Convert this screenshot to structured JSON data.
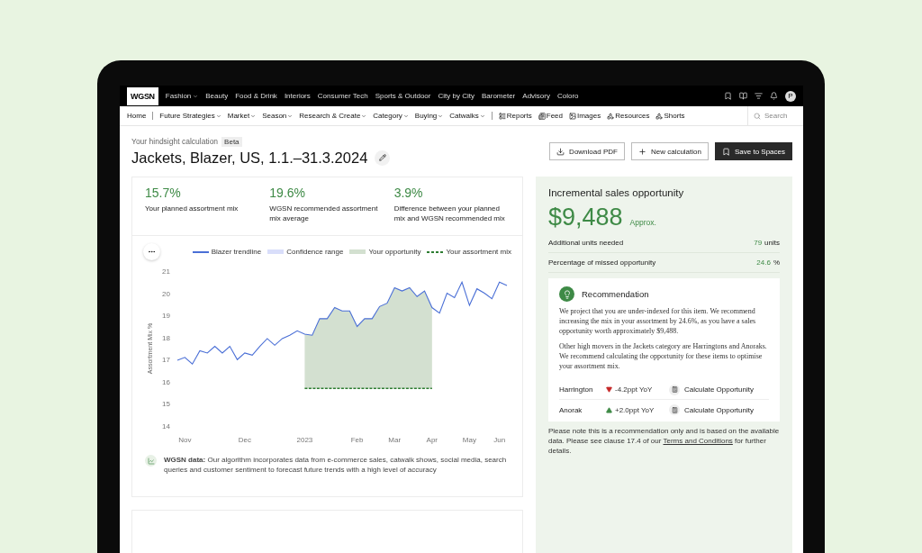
{
  "brand": "WGSN",
  "top_nav": [
    {
      "label": "Fashion",
      "dropdown": true
    },
    {
      "label": "Beauty",
      "dropdown": false
    },
    {
      "label": "Food & Drink",
      "dropdown": false
    },
    {
      "label": "Interiors",
      "dropdown": false
    },
    {
      "label": "Consumer Tech",
      "dropdown": false
    },
    {
      "label": "Sports & Outdoor",
      "dropdown": false
    },
    {
      "label": "City by City",
      "dropdown": false
    },
    {
      "label": "Barometer",
      "dropdown": false
    },
    {
      "label": "Advisory",
      "dropdown": false
    },
    {
      "label": "Coloro",
      "dropdown": false
    }
  ],
  "profile_initial": "P",
  "sub_nav": [
    {
      "label": "Home",
      "kind": "plain"
    },
    {
      "label": "Future Strategies",
      "kind": "menu"
    },
    {
      "label": "Market",
      "kind": "menu"
    },
    {
      "label": "Season",
      "kind": "menu"
    },
    {
      "label": "Research & Create",
      "kind": "menu"
    },
    {
      "label": "Category",
      "kind": "menu"
    },
    {
      "label": "Buying",
      "kind": "menu"
    },
    {
      "label": "Catwalks",
      "kind": "menu"
    },
    {
      "label": "Reports",
      "kind": "icon"
    },
    {
      "label": "Feed",
      "kind": "icon"
    },
    {
      "label": "Images",
      "kind": "icon"
    },
    {
      "label": "Resources",
      "kind": "icon"
    },
    {
      "label": "Shorts",
      "kind": "icon"
    }
  ],
  "search": {
    "placeholder": "Search"
  },
  "page": {
    "eyebrow": "Your hindsight calculation",
    "badge": "Beta",
    "title": "Jackets, Blazer, US, 1.1.–31.3.2024"
  },
  "actions": [
    {
      "label": "Download PDF",
      "kind": "outline"
    },
    {
      "label": "New calculation",
      "kind": "outline"
    },
    {
      "label": "Save to Spaces",
      "kind": "primary"
    }
  ],
  "metrics": [
    {
      "value": "15.7%",
      "label": "Your planned assortment mix"
    },
    {
      "value": "19.6%",
      "label": "WGSN recommended assortment mix average"
    },
    {
      "value": "3.9%",
      "label": "Difference between your planned mix and WGSN recommended mix"
    }
  ],
  "chart": {
    "chart_data": {
      "type": "line",
      "ylabel": "Assortment Mix %",
      "ylim": [
        14,
        21
      ],
      "categories": [
        null,
        "Nov",
        null,
        null,
        null,
        null,
        null,
        null,
        null,
        "Dec",
        null,
        null,
        null,
        null,
        null,
        null,
        null,
        "2023",
        null,
        null,
        null,
        null,
        null,
        null,
        "Feb",
        null,
        null,
        null,
        null,
        "Mar",
        null,
        null,
        null,
        null,
        "Apr",
        null,
        null,
        null,
        null,
        "May",
        null,
        null,
        null,
        "Jun",
        null
      ],
      "series": [
        {
          "name": "Blazer trendline",
          "type": "line",
          "line_style": "solid",
          "color": "#4a6fd6",
          "values": [
            16.97,
            17.1,
            16.8,
            17.4,
            17.3,
            17.6,
            17.3,
            17.6,
            17.0,
            17.3,
            17.2,
            17.6,
            17.95,
            17.65,
            17.95,
            18.1,
            18.3,
            18.15,
            18.1,
            18.85,
            18.85,
            19.35,
            19.2,
            19.2,
            18.5,
            18.85,
            18.85,
            19.4,
            19.55,
            20.25,
            20.1,
            20.25,
            19.85,
            20.1,
            19.35,
            19.1,
            20.0,
            19.8,
            20.5,
            19.45,
            20.2,
            20.0,
            19.75,
            20.5,
            20.35
          ]
        },
        {
          "name": "Confidence range",
          "type": "area",
          "color": "#d9defa",
          "values": [
            null,
            null,
            null,
            null,
            null,
            null,
            null,
            null,
            null,
            null,
            null,
            null,
            null,
            null,
            null,
            null,
            null,
            null,
            null,
            null,
            null,
            null,
            null,
            null,
            null,
            null,
            null,
            null,
            null,
            null,
            null,
            null,
            null,
            null,
            null,
            null,
            null,
            null,
            null,
            null,
            null,
            null,
            null,
            null,
            null
          ]
        },
        {
          "name": "Your opportunity",
          "type": "area",
          "color": "#d3e0d0",
          "values": [
            null,
            null,
            null,
            null,
            null,
            null,
            null,
            null,
            null,
            null,
            null,
            null,
            null,
            null,
            null,
            null,
            null,
            18.15,
            18.1,
            18.85,
            18.85,
            19.35,
            19.2,
            19.2,
            18.5,
            18.85,
            18.85,
            19.4,
            19.55,
            20.25,
            20.1,
            20.25,
            19.85,
            20.1,
            19.35,
            null,
            null,
            null,
            null,
            null,
            null,
            null,
            null,
            null,
            null
          ]
        },
        {
          "name": "Your assortment mix",
          "type": "line",
          "line_style": "dashed",
          "color": "#2e7d32",
          "values": [
            null,
            null,
            null,
            null,
            null,
            null,
            null,
            null,
            null,
            null,
            null,
            null,
            null,
            null,
            null,
            null,
            null,
            15.7,
            15.7,
            15.7,
            15.7,
            15.7,
            15.7,
            15.7,
            15.7,
            15.7,
            15.7,
            15.7,
            15.7,
            15.7,
            15.7,
            15.7,
            15.7,
            15.7,
            15.7,
            null,
            null,
            null,
            null,
            null,
            null,
            null,
            null,
            null,
            null
          ]
        }
      ],
      "yticks": [
        14,
        15,
        16,
        17,
        18,
        19,
        20,
        21
      ]
    },
    "note": "**WGSN data:** Our algorithm incorporates data from e-commerce sales, catwalk shows, social media, search queries and customer sentiment to forecast future trends with a high level of accuracy"
  },
  "opportunity": {
    "title": "Incremental sales opportunity",
    "amount": "$9,488",
    "approx": "Approx.",
    "stats": [
      {
        "label": "Additional units needed",
        "value": "79",
        "unit": "units"
      },
      {
        "label": "Percentage of missed opportunity",
        "value": "24.6",
        "unit": "%"
      }
    ]
  },
  "recommendation": {
    "title": "Recommendation",
    "paragraphs": [
      "We project that you are under-indexed for this item. We recommend increasing the mix in your assortment by 24.6%, as you have a sales opportunity worth approximately $9,488.",
      "Other high movers in the Jackets category are Harringtons and Anoraks. We recommend calculating the opportunity for these items to optimise your assortment mix."
    ],
    "items": [
      {
        "name": "Harrington",
        "change": "-4.2ppt YoY",
        "rising": false,
        "action": "Calculate Opportunity"
      },
      {
        "name": "Anorak",
        "change": "+2.0ppt YoY",
        "rising": true,
        "action": "Calculate Opportunity"
      }
    ]
  },
  "disclaimer": {
    "before": "Please note this is a recommendation only and is based on the available data. Please see clause 17.4 of our",
    "link": "Terms and Conditions",
    "after": "for further details."
  }
}
